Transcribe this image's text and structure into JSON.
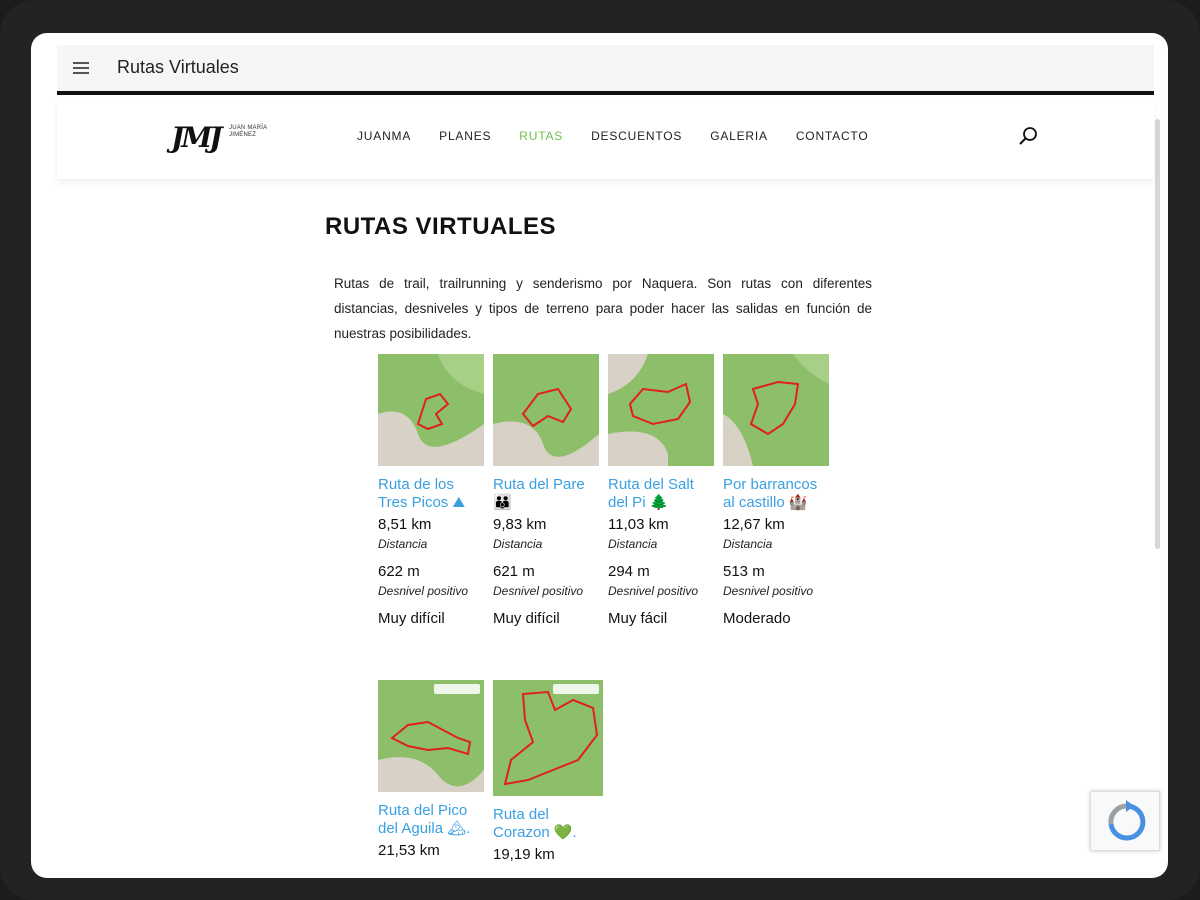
{
  "window": {
    "title": "Rutas Virtuales"
  },
  "site": {
    "logo_mark": "JMJ",
    "logo_text": "JUAN MARÍA JIMÉNEZ",
    "nav": [
      {
        "label": "JUANMA",
        "active": false
      },
      {
        "label": "PLANES",
        "active": false
      },
      {
        "label": "RUTAS",
        "active": true
      },
      {
        "label": "DESCUENTOS",
        "active": false
      },
      {
        "label": "GALERIA",
        "active": false
      },
      {
        "label": "CONTACTO",
        "active": false
      }
    ]
  },
  "page": {
    "title": "RUTAS VIRTUALES",
    "intro": "Rutas de trail, trailrunning y senderismo por Naquera. Son rutas con diferentes distancias, desniveles y tipos de terreno para poder hacer las salidas en función de nuestras posibilidades."
  },
  "routes": [
    {
      "name": "Ruta de los Tres Picos ⛰",
      "distance": "8,51 km",
      "distance_label": "Distancia",
      "elevation": "622 m",
      "elevation_label": "Desnivel positivo",
      "difficulty": "Muy difícil"
    },
    {
      "name": "Ruta del Pare 👪",
      "distance": "9,83 km",
      "distance_label": "Distancia",
      "elevation": "621 m",
      "elevation_label": "Desnivel positivo",
      "difficulty": "Muy difícil"
    },
    {
      "name": "Ruta del Salt del Pi 🌲",
      "distance": "11,03 km",
      "distance_label": "Distancia",
      "elevation": "294 m",
      "elevation_label": "Desnivel positivo",
      "difficulty": "Muy fácil"
    },
    {
      "name": "Por barrancos al castillo 🏰",
      "distance": "12,67 km",
      "distance_label": "Distancia",
      "elevation": "513 m",
      "elevation_label": "Desnivel positivo",
      "difficulty": "Moderado"
    },
    {
      "name": "Ruta del Pico del Aguila 🏔.",
      "distance": "21,53 km"
    },
    {
      "name": "Ruta del Corazon 💚.",
      "distance": "19,19 km"
    }
  ],
  "colors": {
    "accent": "#6cc24a",
    "link": "#3aa0e0",
    "route_line": "#e02020",
    "map_green": "#8dbf6a"
  },
  "icons": {
    "menu": "hamburger-icon",
    "search": "search-icon",
    "recaptcha": "recaptcha-icon"
  }
}
